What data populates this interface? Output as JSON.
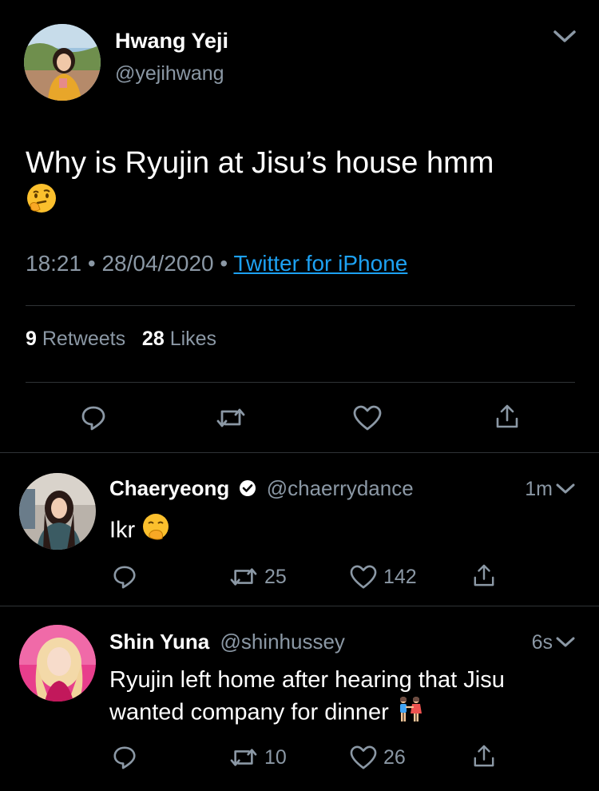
{
  "main_tweet": {
    "name": "Hwang Yeji",
    "handle": "@yejihwang",
    "text": "Why is Ryujin at Jisu’s house hmm",
    "emoji": "thinking-face",
    "time": "18:21",
    "date": "28/04/2020",
    "separator": "•",
    "source": "Twitter for iPhone",
    "retweets_count": "9",
    "retweets_label": "Retweets",
    "likes_count": "28",
    "likes_label": "Likes"
  },
  "replies": [
    {
      "name": "Chaeryeong",
      "verified": true,
      "handle": "@chaerrydance",
      "time": "1m",
      "text": "Ikr",
      "emoji": "face-with-hand-over-mouth",
      "retweets": "25",
      "likes": "142"
    },
    {
      "name": "Shin Yuna",
      "verified": false,
      "handle": "@shinhussey",
      "time": "6s",
      "text_line1": "Ryujin left home after hearing that Jisu",
      "text_line2": "wanted company for dinner",
      "emoji": "two-women-holding-hands",
      "retweets": "10",
      "likes": "26"
    }
  ],
  "colors": {
    "background": "#000000",
    "text": "#ffffff",
    "muted": "#8b98a5",
    "link": "#1da1f2",
    "divider": "#2f3336"
  }
}
